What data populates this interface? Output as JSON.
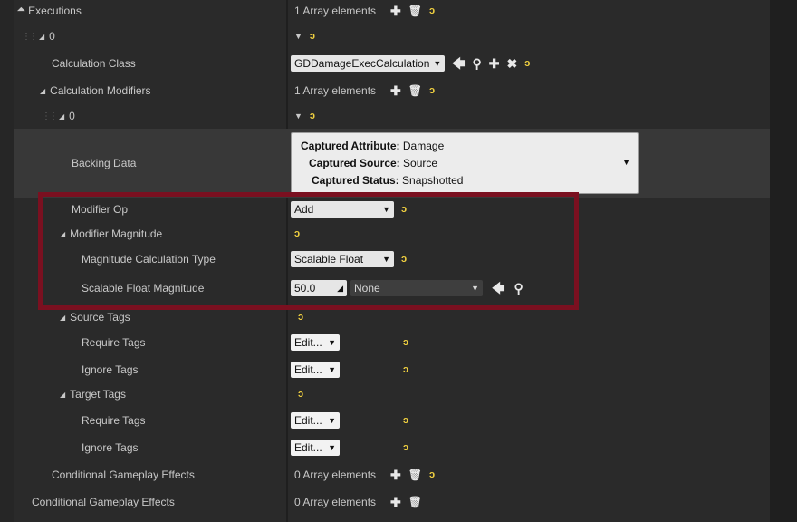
{
  "rows": {
    "executions": {
      "label": "Executions",
      "count": "1 Array elements"
    },
    "exec0": {
      "label": "0"
    },
    "calc_class": {
      "label": "Calculation Class",
      "value": "GDDamageExecCalculation"
    },
    "calc_mods": {
      "label": "Calculation Modifiers",
      "count": "1 Array elements"
    },
    "mod0": {
      "label": "0"
    },
    "backing": {
      "label": "Backing Data",
      "attr_key": "Captured Attribute:",
      "attr_val": "Damage",
      "source_key": "Captured Source:",
      "source_val": "Source",
      "status_key": "Captured Status:",
      "status_val": "Snapshotted"
    },
    "modifier_op": {
      "label": "Modifier Op",
      "value": "Add"
    },
    "modifier_mag": {
      "label": "Modifier Magnitude"
    },
    "mag_calc_type": {
      "label": "Magnitude Calculation Type",
      "value": "Scalable Float"
    },
    "scalable_float": {
      "label": "Scalable Float Magnitude",
      "number": "50.0",
      "curve": "None"
    },
    "source_tags": {
      "label": "Source Tags"
    },
    "src_require": {
      "label": "Require Tags",
      "value": "Edit..."
    },
    "src_ignore": {
      "label": "Ignore Tags",
      "value": "Edit..."
    },
    "target_tags": {
      "label": "Target Tags"
    },
    "tgt_require": {
      "label": "Require Tags",
      "value": "Edit..."
    },
    "tgt_ignore": {
      "label": "Ignore Tags",
      "value": "Edit..."
    },
    "cond_inner": {
      "label": "Conditional Gameplay Effects",
      "count": "0 Array elements"
    },
    "cond_outer": {
      "label": "Conditional Gameplay Effects",
      "count": "0 Array elements"
    }
  },
  "icons": {
    "expand": "▲",
    "add": "+",
    "delete": "🗑",
    "reset": "reset-arrow",
    "back": "🡄",
    "browse": "magnifier",
    "clear": "✖"
  },
  "colors": {
    "highlight_border": "#7a1020",
    "reset_arrow": "#f0d040"
  }
}
